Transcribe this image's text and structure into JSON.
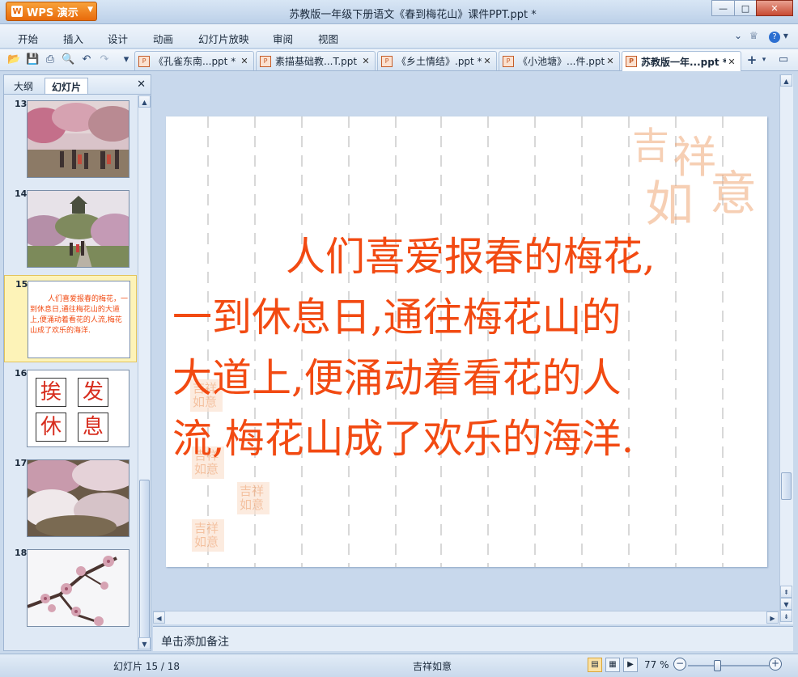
{
  "app": {
    "name": "WPS 演示",
    "logo_letter": "W"
  },
  "window": {
    "title": "苏教版一年级下册语文《春到梅花山》课件PPT.ppt *",
    "controls": {
      "minimize": "—",
      "maximize": "□",
      "close": "✕"
    }
  },
  "menu": {
    "items": [
      "开始",
      "插入",
      "设计",
      "动画",
      "幻灯片放映",
      "审阅",
      "视图"
    ],
    "right": {
      "collapse": "⌄",
      "skin": "♕",
      "help": "?",
      "help_caret": "▾"
    }
  },
  "toolbar": {
    "icons": [
      "open-icon",
      "save-icon",
      "print-icon",
      "print-preview-icon",
      "undo-icon",
      "redo-icon",
      "customize-icon"
    ],
    "glyphs": {
      "open": "📂",
      "save": "💾",
      "print": "⎙",
      "preview": "🔍",
      "undo": "↶",
      "redo": "↷",
      "customize": "▾",
      "new_tab": "+",
      "new_tab_caret": "▾",
      "tab_list": "▭"
    },
    "tab_icon_text": "P",
    "tab_close": "✕"
  },
  "doc_tabs": [
    {
      "label": "《孔雀东南...ppt *",
      "active": false
    },
    {
      "label": "素描基础教...T.ppt",
      "active": false
    },
    {
      "label": "《乡土情结》.ppt *",
      "active": false
    },
    {
      "label": "《小池塘》...件.ppt",
      "active": false
    },
    {
      "label": "苏教版一年...ppt *",
      "active": true
    }
  ],
  "left_panel": {
    "tabs": [
      "大纲",
      "幻灯片"
    ],
    "active_tab": "幻灯片",
    "close": "✕",
    "slides": [
      {
        "number": "13",
        "kind": "photo",
        "colors": [
          "#c9a7b3",
          "#8a6a5a",
          "#d8b8c8"
        ]
      },
      {
        "number": "14",
        "kind": "photo",
        "colors": [
          "#b9a3b9",
          "#5f6b4a",
          "#d9c3d2"
        ]
      },
      {
        "number": "15",
        "kind": "text",
        "selected": true,
        "text": "人们喜爱报春的梅花，一到休息日,通往梅花山的大道上,便涌动着看花的人流,梅花山成了欢乐的海洋."
      },
      {
        "number": "16",
        "kind": "chars",
        "chars": [
          "挨",
          "发",
          "休",
          "息"
        ]
      },
      {
        "number": "17",
        "kind": "photo",
        "colors": [
          "#e8dde2",
          "#a07a8a",
          "#5a5440"
        ]
      },
      {
        "number": "18",
        "kind": "photo",
        "colors": [
          "#f4f4f6",
          "#d8a8b8",
          "#5a3f3a"
        ]
      }
    ]
  },
  "scroll_glyphs": {
    "up": "▲",
    "down": "▼",
    "left": "◀",
    "right": "▶",
    "double_up": "⇞",
    "double_down": "⇟"
  },
  "slide": {
    "text_lines": [
      "人们喜爱报春的梅花,",
      "一到休息日,通往梅花山的",
      "大道上,便涌动着看花的人",
      "流,梅花山成了欢乐的海洋."
    ],
    "text_color": "#f24a12",
    "seal_text": "吉祥如意",
    "seal_color": "#f6c9a8"
  },
  "notes_placeholder": "单击添加备注",
  "status": {
    "slide_counter": "幻灯片 15 / 18",
    "theme": "吉祥如意",
    "zoom": "77 %",
    "zoom_out": "−",
    "zoom_in": "+",
    "zoom_fraction": 0.77,
    "view_glyphs": {
      "normal": "▤",
      "sorter": "▦",
      "show": "▶"
    }
  },
  "colors": {
    "accent_orange": "#e86a0b",
    "chrome_blue": "#c9d9ec"
  }
}
